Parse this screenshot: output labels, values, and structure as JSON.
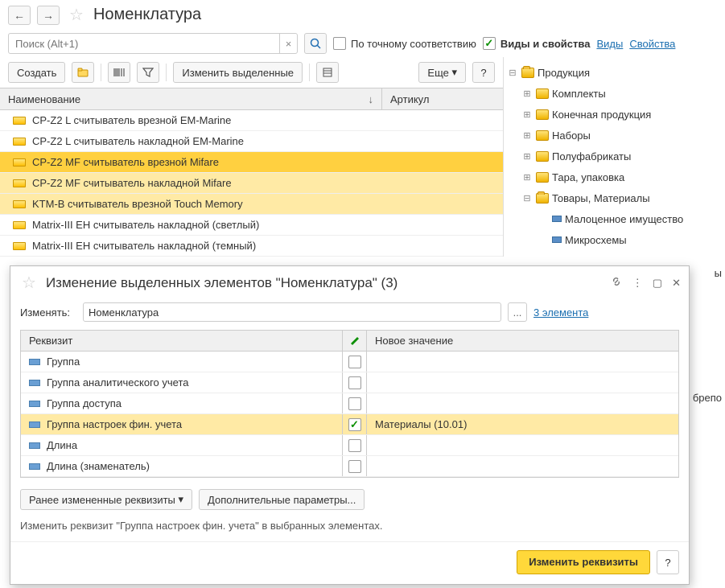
{
  "header": {
    "title": "Номенклатура"
  },
  "search": {
    "placeholder": "Поиск (Alt+1)"
  },
  "filters": {
    "exact_label": "По точному соответствию",
    "types_label": "Виды и свойства",
    "types_link": "Виды",
    "props_link": "Свойства"
  },
  "toolbar": {
    "create": "Создать",
    "change_selected": "Изменить выделенные",
    "more": "Еще",
    "help": "?"
  },
  "grid": {
    "col_name": "Наименование",
    "col_article": "Артикул",
    "rows": [
      {
        "name": "CP-Z2 L считыватель врезной EM-Marine",
        "sel": false,
        "hl": false
      },
      {
        "name": "CP-Z2 L считыватель накладной EM-Marine",
        "sel": false,
        "hl": false
      },
      {
        "name": "CP-Z2 MF считыватель врезной Mifare",
        "sel": true,
        "hl": true
      },
      {
        "name": "CP-Z2 MF считыватель накладной Mifare",
        "sel": false,
        "hl": true
      },
      {
        "name": "KTM-B считыватель врезной  Touch Memory",
        "sel": false,
        "hl": true
      },
      {
        "name": "Matrix-III EH считыватель накладной  (светлый)",
        "sel": false,
        "hl": false
      },
      {
        "name": "Matrix-III EH считыватель накладной  (темный)",
        "sel": false,
        "hl": false
      }
    ]
  },
  "tree": {
    "root": "Продукция",
    "items": [
      "Комплекты",
      "Конечная продукция",
      "Наборы",
      "Полуфабрикаты",
      "Тара, упаковка"
    ],
    "materials": "Товары, Материалы",
    "mat_children": [
      "Малоценное имущество",
      "Микросхемы"
    ],
    "partial1": "ы",
    "partial2": "ы и брепо"
  },
  "dialog": {
    "title": "Изменение выделенных элементов \"Номенклатура\" (3)",
    "change_label": "Изменять:",
    "change_value": "Номенклатура",
    "count_link": "3 элемента",
    "col_req": "Реквизит",
    "col_val": "Новое значение",
    "rows": [
      {
        "name": "Группа",
        "checked": false,
        "value": "",
        "hl": false
      },
      {
        "name": "Группа аналитического учета",
        "checked": false,
        "value": "",
        "hl": false
      },
      {
        "name": "Группа доступа",
        "checked": false,
        "value": "",
        "hl": false
      },
      {
        "name": "Группа настроек фин. учета",
        "checked": true,
        "value": "Материалы (10.01)",
        "hl": true
      },
      {
        "name": "Длина",
        "checked": false,
        "value": "",
        "hl": false
      },
      {
        "name": "Длина (знаменатель)",
        "checked": false,
        "value": "",
        "hl": false
      }
    ],
    "prev_changed": "Ранее измененные реквизиты",
    "extra_params": "Дополнительные параметры...",
    "hint": "Изменить реквизит \"Группа настроек фин. учета\" в выбранных элементах.",
    "apply": "Изменить реквизиты",
    "help": "?"
  }
}
